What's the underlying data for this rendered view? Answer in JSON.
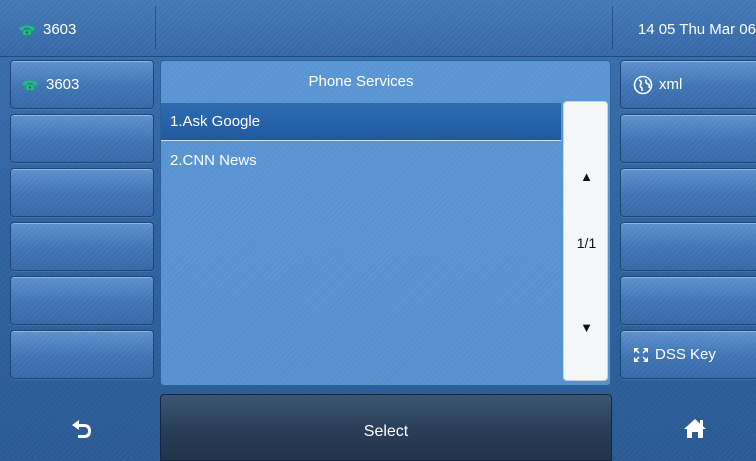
{
  "status_bar": {
    "line_label": "3603",
    "datetime": "14 05 Thu Mar 06"
  },
  "left_keys": [
    {
      "label": "3603",
      "icon": "phone-icon"
    },
    {
      "label": ""
    },
    {
      "label": ""
    },
    {
      "label": ""
    },
    {
      "label": ""
    },
    {
      "label": ""
    }
  ],
  "right_keys": [
    {
      "label": "xml",
      "icon": "globe-icon"
    },
    {
      "label": ""
    },
    {
      "label": ""
    },
    {
      "label": ""
    },
    {
      "label": ""
    },
    {
      "label": "DSS Key",
      "icon": "dss-key-icon"
    }
  ],
  "panel": {
    "title": "Phone Services",
    "items": [
      {
        "label": "1.Ask Google",
        "selected": true
      },
      {
        "label": "2.CNN News",
        "selected": false
      }
    ],
    "scroll": {
      "up_glyph": "▲",
      "down_glyph": "▼",
      "page": "1/1"
    }
  },
  "softkeys": {
    "back_icon": "back-arrow-icon",
    "select_label": "Select",
    "home_icon": "home-icon"
  },
  "colors": {
    "phone_icon": "#19c07a",
    "selected_row": "#2463a8"
  }
}
